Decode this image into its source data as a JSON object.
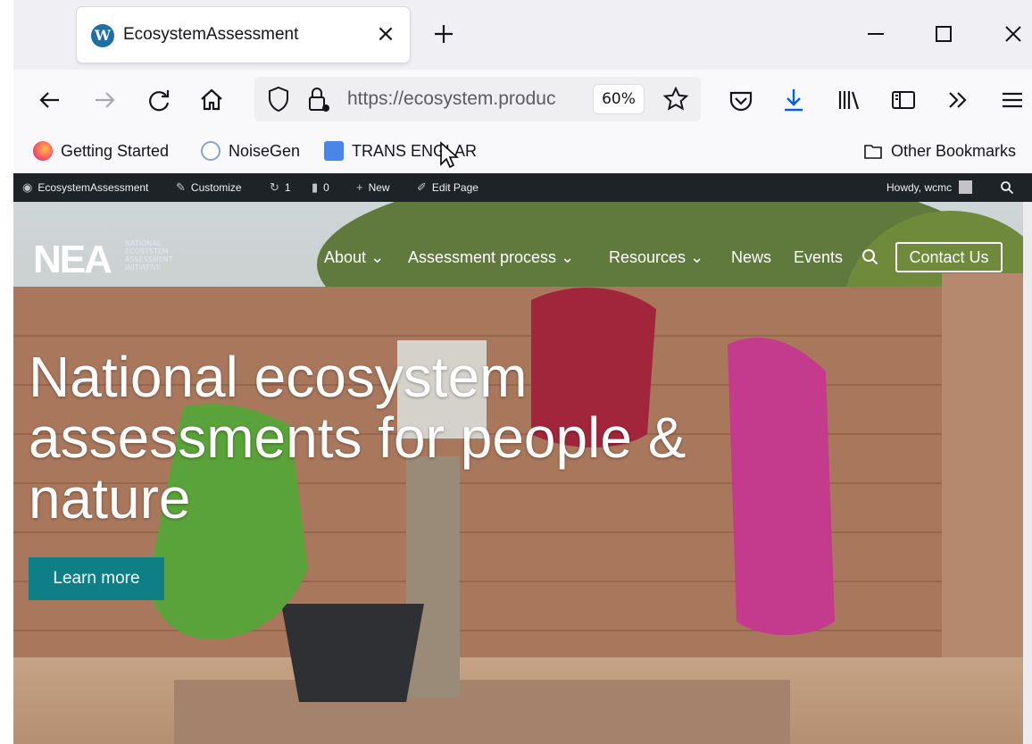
{
  "browser": {
    "tab_title": "EcosystemAssessment",
    "url": "https://ecosystem.produc",
    "zoom": "60%"
  },
  "bookmarks": [
    "Getting Started",
    "NoiseGen",
    "TRANS ENGLAR"
  ],
  "other_bookmarks": "Other Bookmarks",
  "admin_bar": {
    "site": "EcosystemAssessment",
    "customize": "Customize",
    "updates": "1",
    "comments": "0",
    "new": "New",
    "edit": "Edit Page",
    "howdy": "Howdy, wcmc"
  },
  "site": {
    "logo_mark": "NEA",
    "logo_sub": "NATIONAL ECOSYSTEM ASSESSMENT INITIATIVE",
    "nav": [
      "About",
      "Assessment process",
      "Resources",
      "News",
      "Events"
    ],
    "contact": "Contact Us",
    "headline": "National ecosystem assessments for people & nature",
    "cta": "Learn more"
  }
}
